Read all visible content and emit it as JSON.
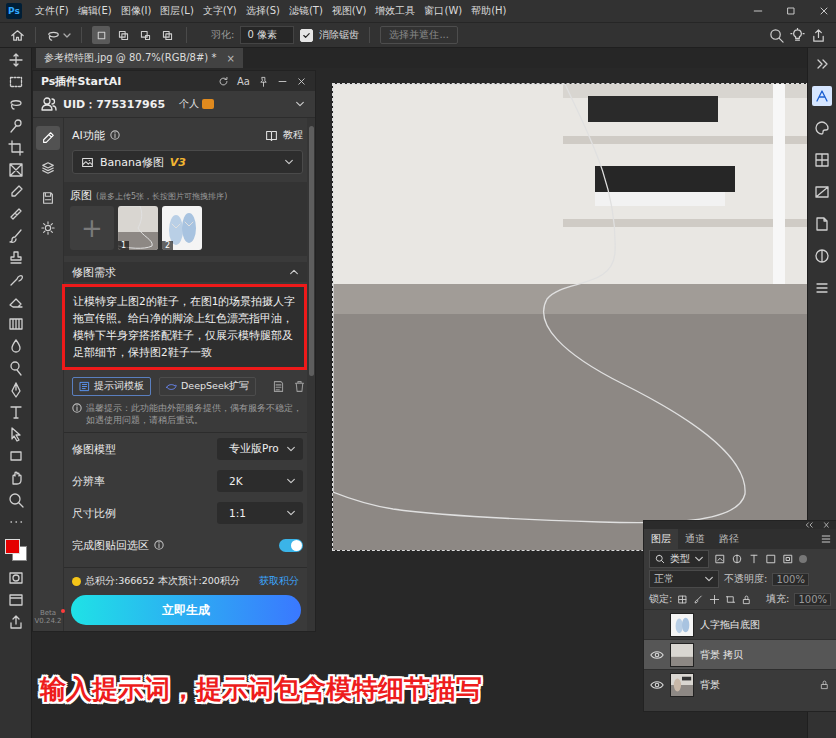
{
  "app": {
    "logo": "Ps"
  },
  "menu": [
    "文件(F)",
    "编辑(E)",
    "图像(I)",
    "图层(L)",
    "文字(Y)",
    "选择(S)",
    "滤镜(T)",
    "视图(V)",
    "增效工具",
    "窗口(W)",
    "帮助(H)"
  ],
  "options_bar": {
    "modes": [
      {
        "selected": true
      },
      {
        "selected": false
      },
      {
        "selected": false
      },
      {
        "selected": false
      }
    ],
    "feather_label": "羽化:",
    "feather_value": "0 像素",
    "antialias": {
      "label": "消除锯齿",
      "checked": true
    },
    "select_mask": {
      "label": "选择并遮住...",
      "disabled": true
    }
  },
  "toolbar": {
    "foreground": "#e50000",
    "background": "#ffffff"
  },
  "document": {
    "tab": "参考模特图.jpg @ 80.7%(RGB/8#) *",
    "close": "×"
  },
  "plugin": {
    "title": "Ps插件StartAI",
    "font_button": "Aa",
    "uid": "UID：775317965",
    "plan": "个人",
    "nav": [
      {
        "selected": true
      },
      {
        "selected": false
      },
      {
        "selected": false
      },
      {
        "selected": false
      }
    ],
    "feature_label": "AI功能",
    "tutorial": "教程",
    "feature": {
      "name": "Banana修图",
      "version": "V3"
    },
    "source": {
      "label": "原图",
      "hint": "(最多上传5张，长按图片可拖拽排序)",
      "add": "+",
      "images": [
        {
          "index": "1",
          "kind": "mask"
        },
        {
          "index": "2",
          "kind": "slippers"
        }
      ]
    },
    "prompt": {
      "label": "修图需求",
      "expanded": true,
      "highlighted": true,
      "text": "让模特穿上图2的鞋子，在图1的场景拍摄人字拖宣传照。给白净的脚涂上红色漂亮指甲油，模特下半身穿搭搭配鞋子，仅展示模特腿部及足部细节，保持图2鞋子一致"
    },
    "prompt_tools": [
      "提示词模板",
      "DeepSeek扩写"
    ],
    "notice": "温馨提示：此功能由外部服务提供，偶有服务不稳定，如遇使用问题，请稍后重试。",
    "settings": [
      {
        "label": "修图模型",
        "kind": "select",
        "value": "专业版Pro",
        "on": false,
        "info": false
      },
      {
        "label": "分辨率",
        "kind": "select",
        "value": "2K",
        "on": false,
        "info": false
      },
      {
        "label": "尺寸比例",
        "kind": "select",
        "value": "1:1",
        "on": false,
        "info": false
      },
      {
        "label": "完成图贴回选区",
        "kind": "toggle",
        "value": "",
        "on": true,
        "info": true
      }
    ],
    "points": "总积分:366652",
    "estimate": "本次预计:200积分",
    "get_points": "获取积分",
    "generate": "立即生成",
    "build": "Beta",
    "version": "V0.24.2"
  },
  "layers_panel": {
    "tabs": [
      {
        "label": "图层",
        "selected": true
      },
      {
        "label": "通道",
        "selected": false
      },
      {
        "label": "路径",
        "selected": false
      }
    ],
    "filter": "类型",
    "blend": "正常",
    "opacity_label": "不透明度:",
    "opacity": "100%",
    "lock_label": "锁定:",
    "fill_label": "填充:",
    "fill": "100%",
    "layers": [
      {
        "name": "人字拖白底图",
        "visible": false,
        "selected": false,
        "locked": false,
        "kind": "smart"
      },
      {
        "name": "背景 拷贝",
        "visible": true,
        "selected": true,
        "locked": false,
        "kind": "mask"
      },
      {
        "name": "背景",
        "visible": true,
        "selected": false,
        "locked": true,
        "kind": "photo"
      }
    ]
  },
  "caption": "输入提示词，提示词包含模特细节描写"
}
